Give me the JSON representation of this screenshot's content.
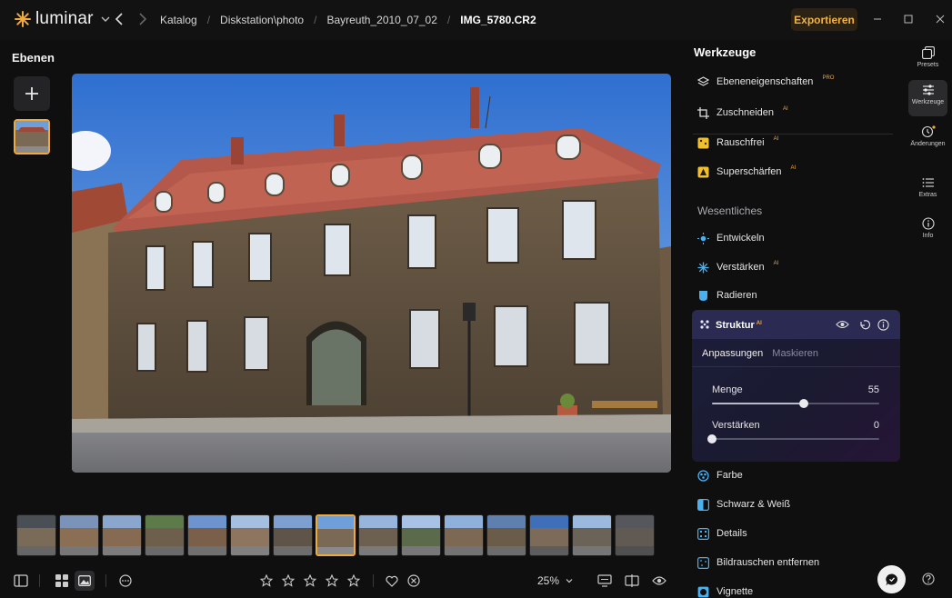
{
  "app": {
    "name": "luminar"
  },
  "breadcrumb": [
    "Katalog",
    "Diskstation\\photo",
    "Bayreuth_2010_07_02",
    "IMG_5780.CR2"
  ],
  "export_label": "Exportieren",
  "layers": {
    "title": "Ebenen"
  },
  "tools": {
    "title": "Werkzeuge",
    "items_top": [
      {
        "label": "Ebeneneigenschaften",
        "badge": "PRO",
        "icon": "layers-icon"
      },
      {
        "label": "Zuschneiden",
        "badge": "AI",
        "icon": "crop-icon"
      },
      {
        "label": "Rauschfrei",
        "badge": "AI",
        "icon": "noiseless-icon"
      },
      {
        "label": "Superschärfen",
        "badge": "AI",
        "icon": "supersharp-icon"
      }
    ],
    "section": "Wesentliches",
    "items_essentials": [
      {
        "label": "Entwickeln",
        "badge": "",
        "icon": "sun-icon"
      },
      {
        "label": "Verstärken",
        "badge": "AI",
        "icon": "sparkle-icon"
      },
      {
        "label": "Radieren",
        "badge": "",
        "icon": "eraser-icon"
      }
    ],
    "structure": {
      "title": "Struktur",
      "badge": "AI",
      "tabs": [
        "Anpassungen",
        "Maskieren"
      ],
      "sliders": [
        {
          "label": "Menge",
          "value": "55",
          "fraction": 0.55
        },
        {
          "label": "Verstärken",
          "value": "0",
          "fraction": 0.0
        }
      ]
    },
    "items_bottom": [
      {
        "label": "Farbe",
        "badge": "",
        "icon": "color-icon"
      },
      {
        "label": "Schwarz & Weiß",
        "badge": "",
        "icon": "bw-icon"
      },
      {
        "label": "Details",
        "badge": "",
        "icon": "details-icon"
      },
      {
        "label": "Bildrauschen entfernen",
        "badge": "",
        "icon": "denoise-icon"
      },
      {
        "label": "Vignette",
        "badge": "",
        "icon": "vignette-icon"
      }
    ]
  },
  "rail": [
    {
      "label": "Presets",
      "icon": "presets-icon"
    },
    {
      "label": "Werkzeuge",
      "icon": "sliders-icon"
    },
    {
      "label": "Änderungen",
      "icon": "history-icon"
    },
    {
      "label": "Extras",
      "icon": "list-icon"
    },
    {
      "label": "Info",
      "icon": "info-icon"
    }
  ],
  "zoom_label": "25%",
  "filmstrip": {
    "count": 15,
    "selected_index": 7
  },
  "colors": {
    "accent": "#f0a93b",
    "structure_header": "#2a2a52",
    "background": "#0f0f10"
  }
}
